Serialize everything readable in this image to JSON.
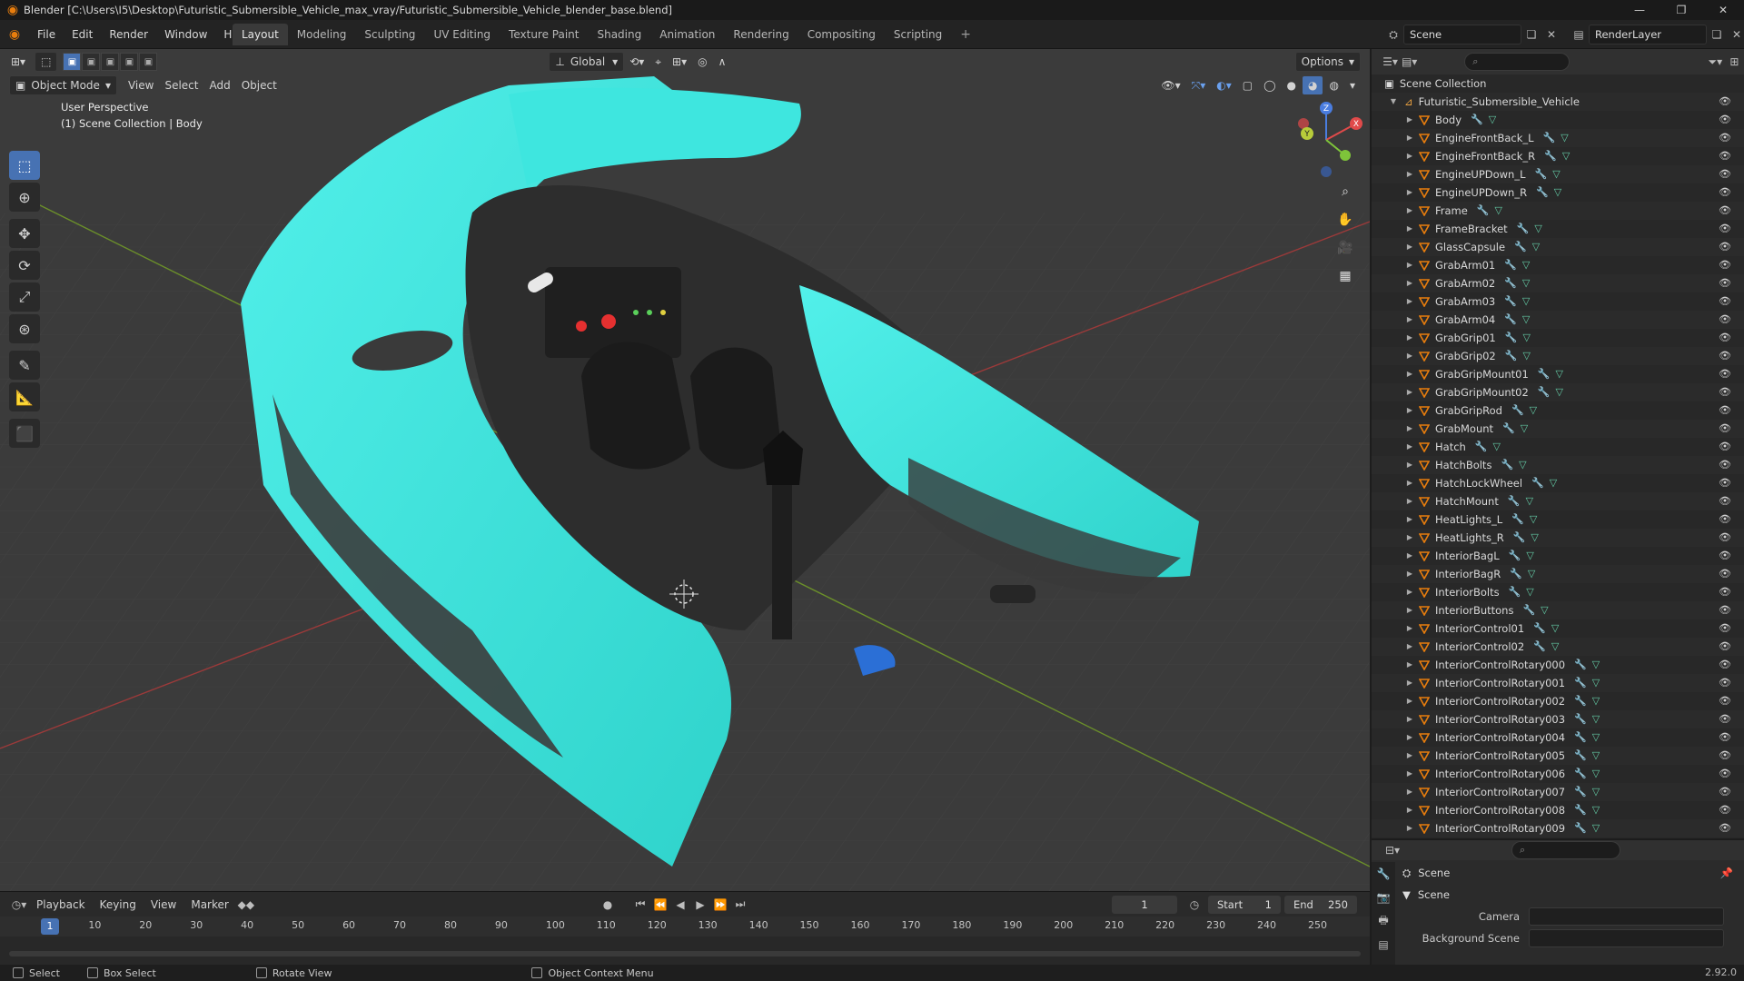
{
  "window": {
    "title": "Blender [C:\\Users\\I5\\Desktop\\Futuristic_Submersible_Vehicle_max_vray/Futuristic_Submersible_Vehicle_blender_base.blend]",
    "min": "—",
    "max": "❐",
    "close": "✕"
  },
  "menu": [
    "File",
    "Edit",
    "Render",
    "Window",
    "Help"
  ],
  "workspaces": [
    "Layout",
    "Modeling",
    "Sculpting",
    "UV Editing",
    "Texture Paint",
    "Shading",
    "Animation",
    "Rendering",
    "Compositing",
    "Scripting"
  ],
  "workspace_add": "+",
  "scene": {
    "name": "Scene",
    "view_layer": "RenderLayer"
  },
  "viewport": {
    "orientation": "Global",
    "options": "Options",
    "mode": "Object Mode",
    "menu": [
      "View",
      "Select",
      "Add",
      "Object"
    ],
    "perspective": "User Perspective",
    "collection_info": "(1) Scene Collection | Body",
    "gizmo": {
      "x": "X",
      "y": "Y",
      "z": "Z"
    }
  },
  "outliner": {
    "search_placeholder": "",
    "root": "Scene Collection",
    "collection": "Futuristic_Submersible_Vehicle",
    "objects": [
      "Body",
      "EngineFrontBack_L",
      "EngineFrontBack_R",
      "EngineUPDown_L",
      "EngineUPDown_R",
      "Frame",
      "FrameBracket",
      "GlassCapsule",
      "GrabArm01",
      "GrabArm02",
      "GrabArm03",
      "GrabArm04",
      "GrabGrip01",
      "GrabGrip02",
      "GrabGripMount01",
      "GrabGripMount02",
      "GrabGripRod",
      "GrabMount",
      "Hatch",
      "HatchBolts",
      "HatchLockWheel",
      "HatchMount",
      "HeatLights_L",
      "HeatLights_R",
      "InteriorBagL",
      "InteriorBagR",
      "InteriorBolts",
      "InteriorButtons",
      "InteriorControl01",
      "InteriorControl02",
      "InteriorControlRotary000",
      "InteriorControlRotary001",
      "InteriorControlRotary002",
      "InteriorControlRotary003",
      "InteriorControlRotary004",
      "InteriorControlRotary005",
      "InteriorControlRotary006",
      "InteriorControlRotary007",
      "InteriorControlRotary008",
      "InteriorControlRotary009"
    ]
  },
  "properties": {
    "title": "Scene",
    "panel": "Scene",
    "camera_label": "Camera",
    "background_label": "Background Scene"
  },
  "timeline": {
    "menu": [
      "Playback",
      "Keying",
      "View",
      "Marker"
    ],
    "current_frame": "1",
    "start_label": "Start",
    "start": "1",
    "end_label": "End",
    "end": "250",
    "ticks": [
      "1",
      "10",
      "20",
      "30",
      "40",
      "50",
      "60",
      "70",
      "80",
      "90",
      "100",
      "110",
      "120",
      "130",
      "140",
      "150",
      "160",
      "170",
      "180",
      "190",
      "200",
      "210",
      "220",
      "230",
      "240",
      "250"
    ]
  },
  "status": {
    "select": "Select",
    "box_select": "Box Select",
    "rotate": "Rotate View",
    "context": "Object Context Menu",
    "version": "2.92.0"
  },
  "colors": {
    "accent": "#4772b3",
    "vehicle": "#3ee6df",
    "object": "#e87d0d"
  }
}
